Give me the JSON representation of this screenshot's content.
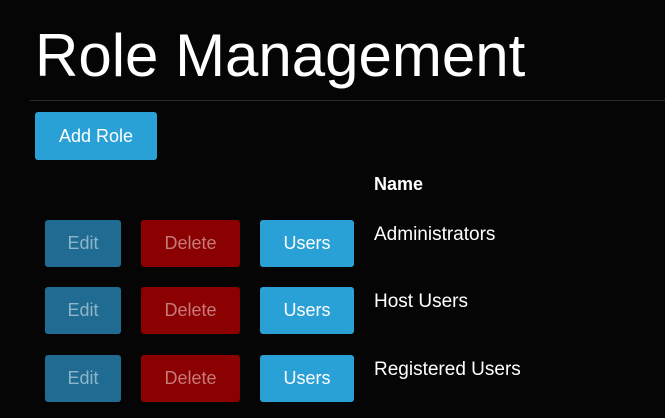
{
  "page": {
    "title": "Role Management"
  },
  "toolbar": {
    "add_role_label": "Add Role"
  },
  "table": {
    "columns": [
      "Name"
    ],
    "rows": [
      {
        "name": "Administrators",
        "edit_label": "Edit",
        "delete_label": "Delete",
        "users_label": "Users"
      },
      {
        "name": "Host Users",
        "edit_label": "Edit",
        "delete_label": "Delete",
        "users_label": "Users"
      },
      {
        "name": "Registered Users",
        "edit_label": "Edit",
        "delete_label": "Delete",
        "users_label": "Users"
      }
    ]
  },
  "colors": {
    "primary": "#2aa1d6",
    "edit_disabled": "#1f6b91",
    "delete_disabled": "#8b0000",
    "background": "#050505"
  }
}
